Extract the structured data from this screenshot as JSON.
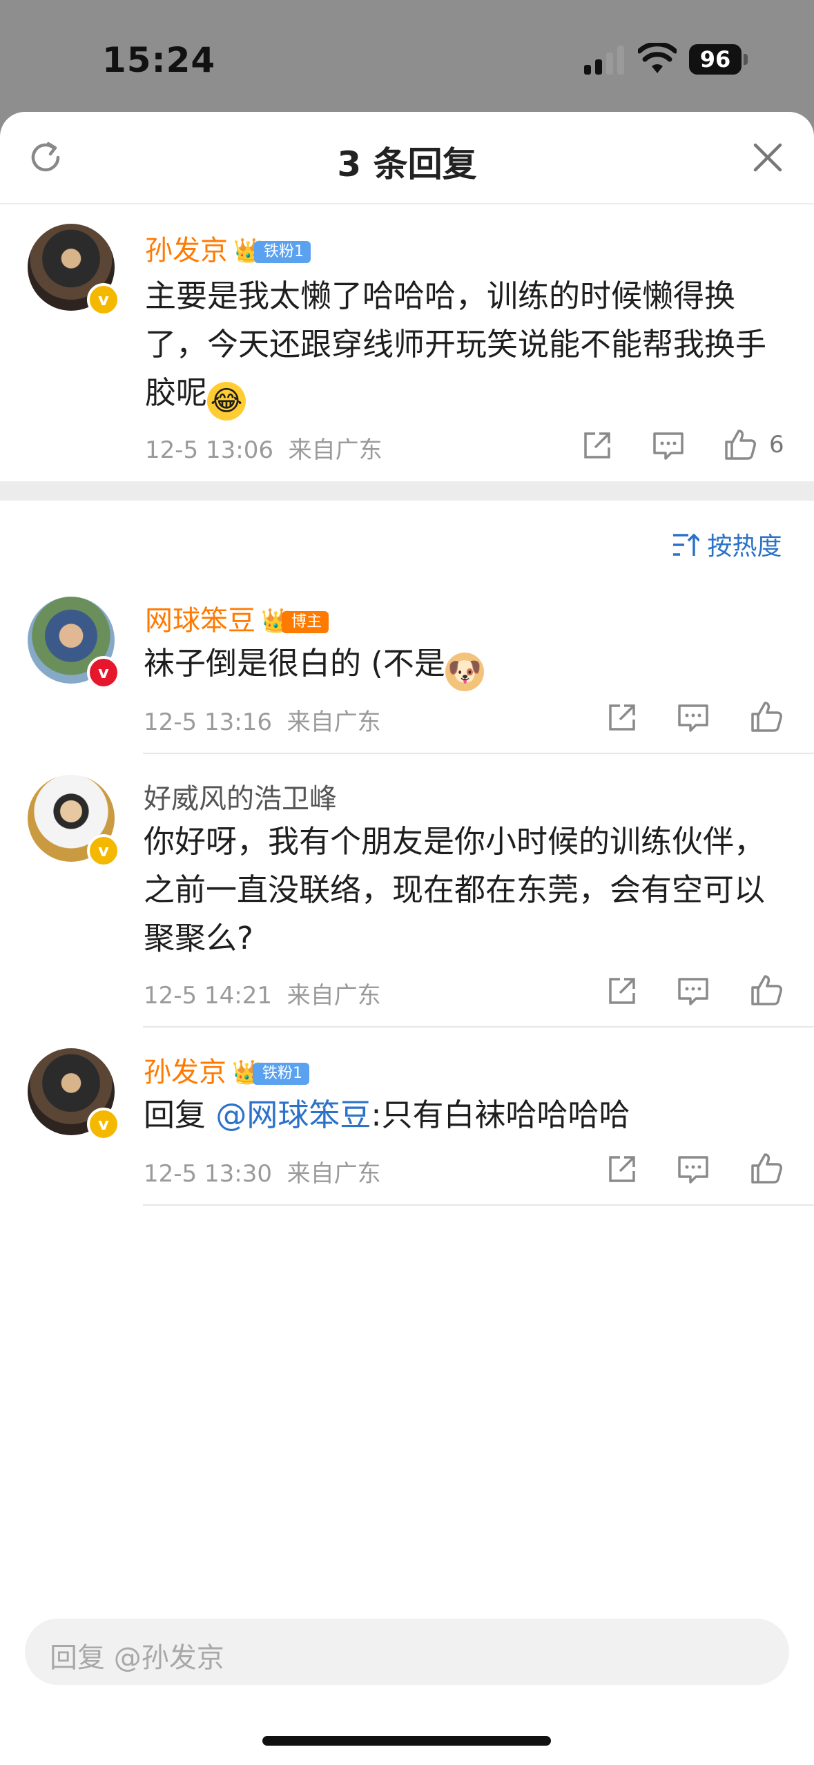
{
  "status": {
    "time": "15:24",
    "battery": "96"
  },
  "header": {
    "title": "3 条回复"
  },
  "top_comment": {
    "username": "孙发京",
    "fan_badge": "铁粉1",
    "text": "主要是我太懒了哈哈哈，训练的时候懒得换了，今天还跟穿线师开玩笑说能不能帮我换手胶呢",
    "emoji": "😂",
    "time": "12-5 13:06",
    "location": "来自广东",
    "likes": "6"
  },
  "sort": {
    "label": "按热度"
  },
  "replies": [
    {
      "username": "网球笨豆",
      "badge": "博主",
      "text": "袜子倒是很白的 (不是",
      "emoji": "🐶",
      "time": "12-5 13:16",
      "location": "来自广东"
    },
    {
      "username": "好威风的浩卫峰",
      "text": "你好呀，我有个朋友是你小时候的训练伙伴，之前一直没联络，现在都在东莞，会有空可以聚聚么?",
      "time": "12-5 14:21",
      "location": "来自广东"
    },
    {
      "username": "孙发京",
      "fan_badge": "铁粉1",
      "reply_prefix": "回复",
      "mention": "@网球笨豆",
      "text": ":只有白袜哈哈哈哈",
      "time": "12-5 13:30",
      "location": "来自广东"
    }
  ],
  "reply_input": {
    "placeholder": "回复 @孙发京"
  },
  "colors": {
    "accent_orange": "#ff7a00",
    "link_blue": "#2c72c8",
    "verified_gold": "#f5b800",
    "verified_red": "#e6162d"
  }
}
